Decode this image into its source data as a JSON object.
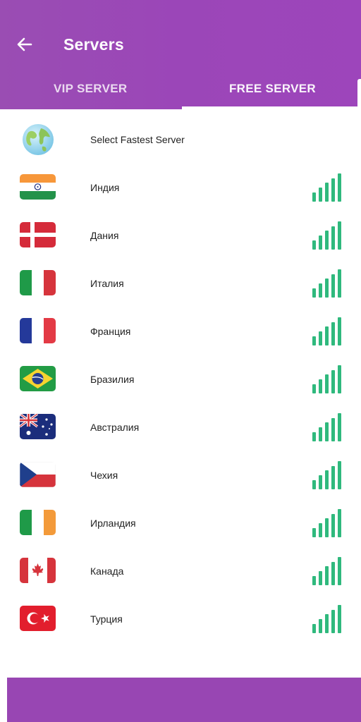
{
  "header": {
    "title": "Servers",
    "back_icon": "arrow-left-icon",
    "tabs": [
      {
        "label": "VIP SERVER",
        "selected": false
      },
      {
        "label": "FREE SERVER",
        "selected": true
      }
    ]
  },
  "servers": [
    {
      "name": "Select Fastest Server",
      "icon": "globe-icon",
      "signal": null
    },
    {
      "name": "Индия",
      "icon": "flag-india-icon",
      "signal": "signal-full-icon"
    },
    {
      "name": "Дания",
      "icon": "flag-denmark-icon",
      "signal": "signal-full-icon"
    },
    {
      "name": "Италия",
      "icon": "flag-italy-icon",
      "signal": "signal-full-icon"
    },
    {
      "name": "Франция",
      "icon": "flag-france-icon",
      "signal": "signal-full-icon"
    },
    {
      "name": "Бразилия",
      "icon": "flag-brazil-icon",
      "signal": "signal-full-icon"
    },
    {
      "name": "Австралия",
      "icon": "flag-australia-icon",
      "signal": "signal-full-icon"
    },
    {
      "name": "Чехия",
      "icon": "flag-czech-icon",
      "signal": "signal-full-icon"
    },
    {
      "name": "Ирландия",
      "icon": "flag-ireland-icon",
      "signal": "signal-full-icon"
    },
    {
      "name": "Канада",
      "icon": "flag-canada-icon",
      "signal": "signal-full-icon"
    },
    {
      "name": "Турция",
      "icon": "flag-turkey-icon",
      "signal": "signal-full-icon"
    }
  ],
  "colors": {
    "header": "#9b47b8",
    "signal": "#2fb97d",
    "bottom_bar": "#9846b3"
  }
}
